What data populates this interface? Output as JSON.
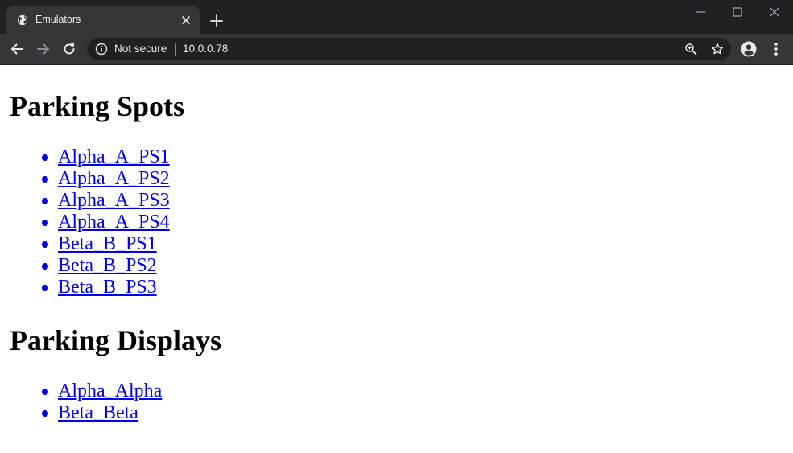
{
  "browser": {
    "tab": {
      "title": "Emulators",
      "favicon": "globe-icon",
      "close_icon": "close-icon"
    },
    "new_tab_icon": "plus-icon",
    "window_controls": [
      "minimize-icon",
      "maximize-icon",
      "close-icon"
    ],
    "toolbar": {
      "back_icon": "arrow-left-icon",
      "forward_icon": "arrow-right-icon",
      "reload_icon": "reload-icon",
      "security_icon": "info-icon",
      "security_label": "Not secure",
      "url": "10.0.0.78",
      "zoom_icon": "zoom-icon",
      "bookmark_icon": "star-icon",
      "profile_icon": "account-icon",
      "menu_icon": "more-vert-icon"
    },
    "colors": {
      "tabstrip_bg": "#202124",
      "toolbar_bg": "#35363a",
      "omnibox_bg": "#202124",
      "chrome_text": "#e8eaed",
      "link": "#0000ee"
    }
  },
  "page": {
    "sections": [
      {
        "heading": "Parking Spots",
        "links": [
          "Alpha_A_PS1",
          "Alpha_A_PS2",
          "Alpha_A_PS3",
          "Alpha_A_PS4",
          "Beta_B_PS1",
          "Beta_B_PS2",
          "Beta_B_PS3"
        ]
      },
      {
        "heading": "Parking Displays",
        "links": [
          "Alpha_Alpha",
          "Beta_Beta"
        ]
      }
    ]
  }
}
